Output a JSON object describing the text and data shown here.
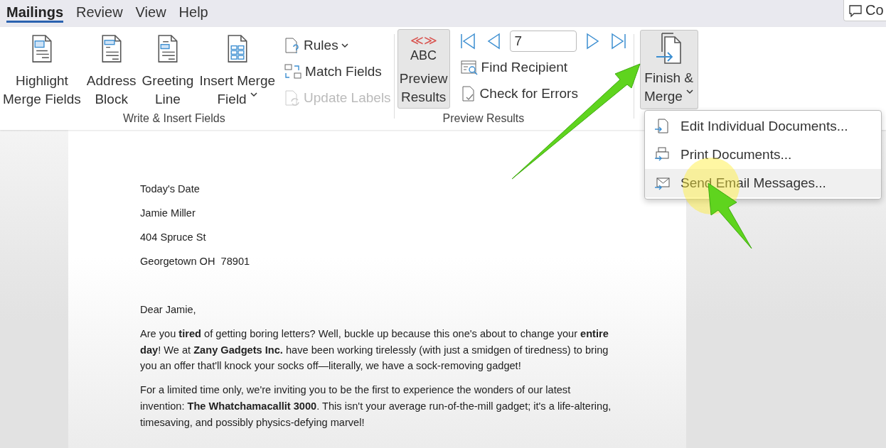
{
  "tabs": [
    {
      "label": "Mailings",
      "selected": true
    },
    {
      "label": "Review",
      "selected": false
    },
    {
      "label": "View",
      "selected": false
    },
    {
      "label": "Help",
      "selected": false
    }
  ],
  "comments_button": {
    "label": "Co"
  },
  "ribbon": {
    "groups": [
      {
        "label": "Write & Insert Fields",
        "large_buttons": [
          {
            "lines": [
              "Highlight",
              "Merge Fields"
            ],
            "dropdown": false
          },
          {
            "lines": [
              "Address",
              "Block"
            ],
            "dropdown": false
          },
          {
            "lines": [
              "Greeting",
              "Line"
            ],
            "dropdown": false
          },
          {
            "lines": [
              "Insert Merge",
              "Field"
            ],
            "dropdown": true
          }
        ],
        "small_buttons": [
          {
            "label": "Rules",
            "dropdown": true,
            "disabled": false
          },
          {
            "label": "Match Fields",
            "dropdown": false,
            "disabled": false
          },
          {
            "label": "Update Labels",
            "dropdown": false,
            "disabled": true
          }
        ]
      },
      {
        "label": "Preview Results",
        "preview_button": {
          "marks": "≪≫",
          "abc": "ABC",
          "lines": [
            "Preview",
            "Results"
          ],
          "selected": true
        },
        "record": "7",
        "small_buttons": [
          {
            "label": "Find Recipient"
          },
          {
            "label": "Check for Errors"
          }
        ]
      },
      {
        "finish_button": {
          "lines": [
            "Finish &",
            "Merge"
          ],
          "dropdown": true,
          "expanded": true
        }
      }
    ]
  },
  "menu": {
    "items": [
      {
        "label": "Edit Individual Documents...",
        "selected": false
      },
      {
        "label": "Print Documents...",
        "selected": false
      },
      {
        "label": "Send Email Messages...",
        "selected": true
      }
    ]
  },
  "letter": {
    "address": [
      "Today's Date",
      "Jamie Miller",
      "404 Spruce St",
      "Georgetown OH  78901"
    ],
    "salutation": "Dear Jamie,",
    "paragraphs": [
      "Are you **tired** of getting boring letters? Well, buckle up because this one's about to change your **entire day**! We at **Zany Gadgets Inc.** have been working tirelessly (with just a smidgen of tiredness) to bring you an offer that'll knock your socks off—literally, we have a sock-removing gadget!",
      "For a limited time only, we're inviting you to be the first to experience the wonders of our latest invention: **The Whatchamacallit 3000**. This isn't your average run-of-the-mill gadget; it's a life-altering, timesaving, and possibly physics-defying marvel!"
    ]
  }
}
